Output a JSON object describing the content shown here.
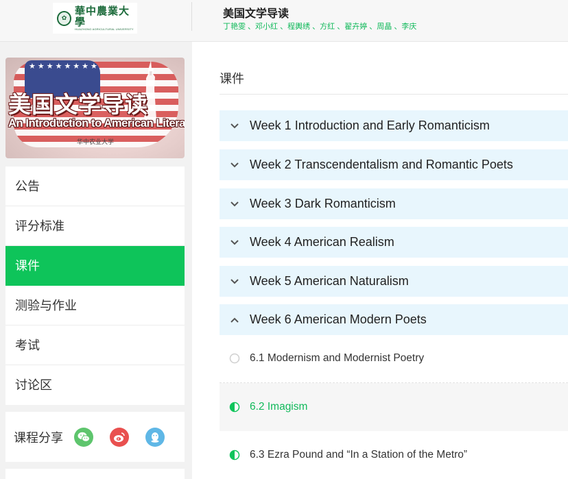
{
  "header": {
    "logo_cn": "華中農業大學",
    "logo_en": "HUAZHONG AGRICULTURAL UNIVERSITY",
    "course_title": "美国文学导读",
    "teachers": "丁艳雯 、邓小红 、程輿绣 、方红 、翟卉婷 、周晶 、李庆"
  },
  "banner": {
    "title_cn": "美国文学导读",
    "title_en": "An Introduction to American Literature",
    "subtitle": "华中农业大学",
    "stars": "★★★★★★★★★★★★★★★★★★★★★★★★★★★★★★★★★★★★★★★★"
  },
  "sidebar": {
    "items": [
      {
        "label": "公告"
      },
      {
        "label": "评分标准"
      },
      {
        "label": "课件"
      },
      {
        "label": "测验与作业"
      },
      {
        "label": "考试"
      },
      {
        "label": "讨论区"
      }
    ],
    "active_index": 2,
    "share_label": "课程分享"
  },
  "main": {
    "section_title": "课件",
    "weeks": [
      {
        "label": "Week 1 Introduction and Early Romanticism",
        "expanded": false
      },
      {
        "label": "Week 2 Transcendentalism and Romantic Poets",
        "expanded": false
      },
      {
        "label": "Week 3 Dark Romanticism",
        "expanded": false
      },
      {
        "label": "Week 4 American Realism",
        "expanded": false
      },
      {
        "label": "Week 5 American Naturalism",
        "expanded": false
      },
      {
        "label": "Week 6 American Modern Poets",
        "expanded": true
      }
    ],
    "lessons": [
      {
        "label": "6.1 Modernism and Modernist Poetry",
        "status": "not-started"
      },
      {
        "label": "6.2 Imagism",
        "status": "in-progress",
        "current": true
      },
      {
        "label": "6.3 Ezra Pound and “In a Station of the Metro”",
        "status": "in-progress"
      }
    ]
  },
  "colors": {
    "accent_green": "#0ec45a",
    "week_bg": "#e8f6fd",
    "wechat": "#5ec56d",
    "weibo": "#e9504f",
    "qq": "#5fb7e6"
  }
}
